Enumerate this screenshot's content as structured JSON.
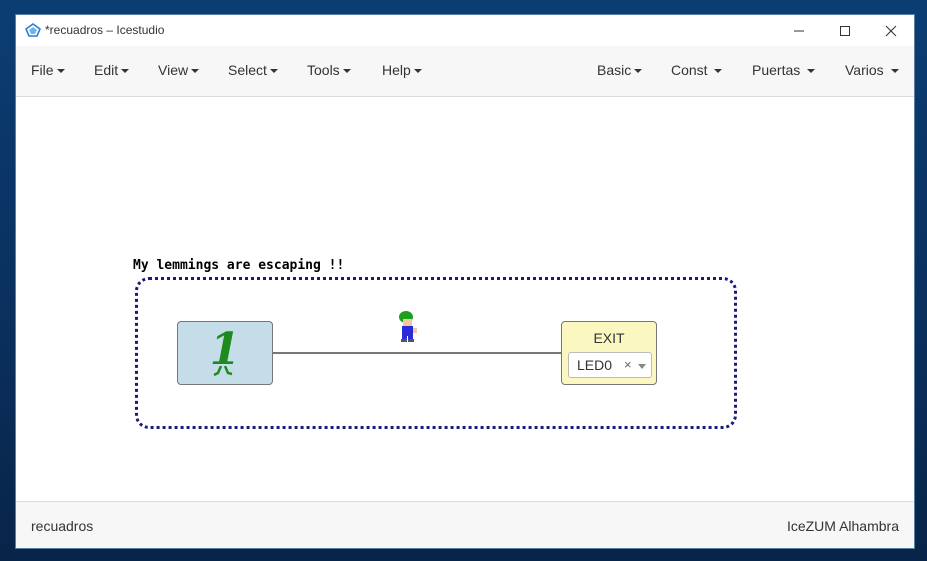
{
  "window": {
    "title": "*recuadros – Icestudio"
  },
  "menu_left": [
    {
      "label": "File"
    },
    {
      "label": "Edit"
    },
    {
      "label": "View"
    },
    {
      "label": "Select"
    },
    {
      "label": "Tools"
    },
    {
      "label": "Help"
    }
  ],
  "menu_right": [
    {
      "label": "Basic"
    },
    {
      "label": "Const"
    },
    {
      "label": "Puertas"
    },
    {
      "label": "Varios"
    }
  ],
  "canvas": {
    "comment": "My lemmings are escaping !!",
    "const_block": {
      "value": "1"
    },
    "output_block": {
      "name": "EXIT",
      "selected": "LED0",
      "clear": "×"
    }
  },
  "status": {
    "file": "recuadros",
    "board": "IceZUM Alhambra"
  },
  "colors": {
    "accent_frame": "#1a1a7a",
    "const_bg": "#c5dde8",
    "output_bg": "#fbf7c1"
  }
}
